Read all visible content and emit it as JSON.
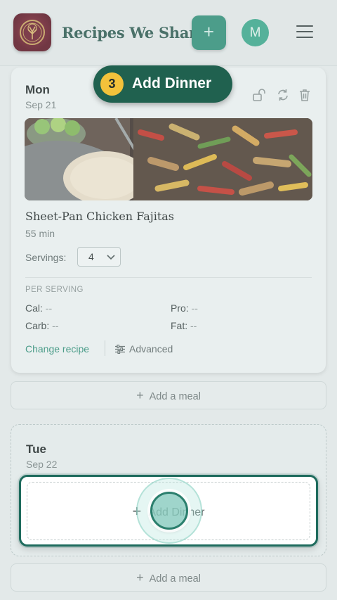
{
  "header": {
    "app_title": "Recipes We Share",
    "add_icon": "plus-icon",
    "avatar_initial": "M",
    "menu_icon": "hamburger-icon"
  },
  "tour": {
    "step_number": "3",
    "step_label": "Add Dinner"
  },
  "days": [
    {
      "day": "Mon",
      "date": "Sep 21",
      "icons": [
        "unlock-icon",
        "refresh-icon",
        "trash-icon"
      ],
      "meal": {
        "title": "Sheet-Pan Chicken Fajitas",
        "time": "55 min",
        "servings_label": "Servings:",
        "servings_value": "4",
        "per_serving_label": "PER SERVING",
        "nutrition": [
          {
            "label": "Cal:",
            "value": "--"
          },
          {
            "label": "Pro:",
            "value": "--"
          },
          {
            "label": "Carb:",
            "value": "--"
          },
          {
            "label": "Fat:",
            "value": "--"
          }
        ],
        "change_recipe": "Change recipe",
        "advanced": "Advanced"
      },
      "add_meal": "Add a meal"
    },
    {
      "day": "Tue",
      "date": "Sep 22",
      "add_dinner": "Add Dinner",
      "add_meal": "Add a meal"
    }
  ],
  "colors": {
    "accent": "#2f8f78",
    "brand_dark": "#20614f",
    "step_badge": "#f3c23b"
  }
}
